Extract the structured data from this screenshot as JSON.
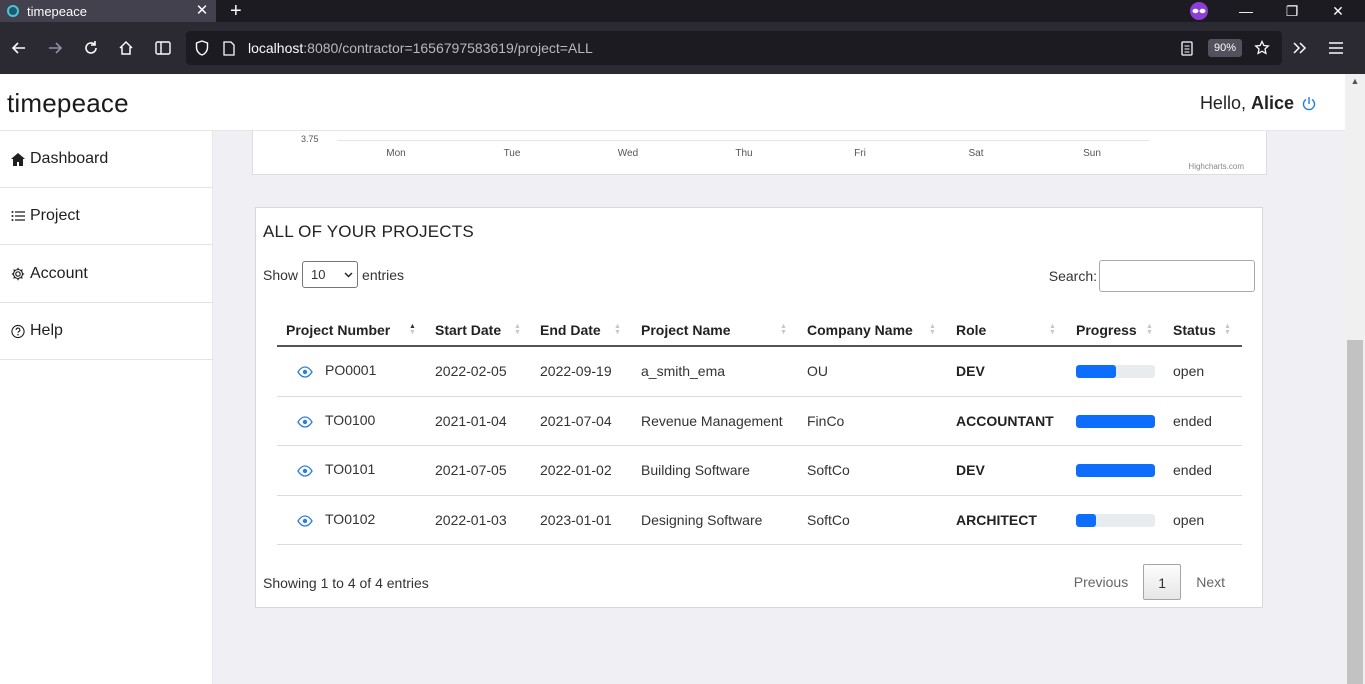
{
  "browser": {
    "tab_title": "timepeace",
    "tab_close": "✕",
    "new_tab": "+",
    "url_host": "localhost",
    "url_rest": ":8080/contractor=1656797583619/project=ALL",
    "zoom": "90%",
    "window_controls": {
      "minimize": "—",
      "restore": "❐",
      "close": "✕"
    }
  },
  "header": {
    "brand": "timepeace",
    "greeting": "Hello,",
    "user_name": "Alice"
  },
  "sidebar": {
    "items": [
      {
        "label": "Dashboard",
        "icon": "home-icon"
      },
      {
        "label": "Project",
        "icon": "list-icon"
      },
      {
        "label": "Account",
        "icon": "gear-icon"
      },
      {
        "label": "Help",
        "icon": "question-icon"
      }
    ]
  },
  "chart": {
    "y_tick": "3.75",
    "x_labels": [
      "Mon",
      "Tue",
      "Wed",
      "Thu",
      "Fri",
      "Sat",
      "Sun"
    ],
    "credit": "Highcharts.com"
  },
  "projects": {
    "title": "ALL OF YOUR PROJECTS",
    "show_label": "Show",
    "entries_value": "10",
    "entries_label": "entries",
    "search_label": "Search:",
    "search_value": "",
    "columns": [
      "Project Number",
      "Start Date",
      "End Date",
      "Project Name",
      "Company Name",
      "Role",
      "Progress",
      "Status"
    ],
    "rows": [
      {
        "number": "PO0001",
        "start": "2022-02-05",
        "end": "2022-09-19",
        "name": "a_smith_ema",
        "company": "OU",
        "role": "DEV",
        "progress": 0.5,
        "status": "open"
      },
      {
        "number": "TO0100",
        "start": "2021-01-04",
        "end": "2021-07-04",
        "name": "Revenue Management",
        "company": "FinCo",
        "role": "ACCOUNTANT",
        "progress": 1.0,
        "status": "ended"
      },
      {
        "number": "TO0101",
        "start": "2021-07-05",
        "end": "2022-01-02",
        "name": "Building Software",
        "company": "SoftCo",
        "role": "DEV",
        "progress": 1.0,
        "status": "ended"
      },
      {
        "number": "TO0102",
        "start": "2022-01-03",
        "end": "2023-01-01",
        "name": "Designing Software",
        "company": "SoftCo",
        "role": "ARCHITECT",
        "progress": 0.25,
        "status": "open"
      }
    ],
    "info": "Showing 1 to 4 of 4 entries",
    "pager": {
      "previous": "Previous",
      "current": "1",
      "next": "Next"
    }
  },
  "colors": {
    "accent": "#0d6efd",
    "eye": "#2a7de1"
  }
}
